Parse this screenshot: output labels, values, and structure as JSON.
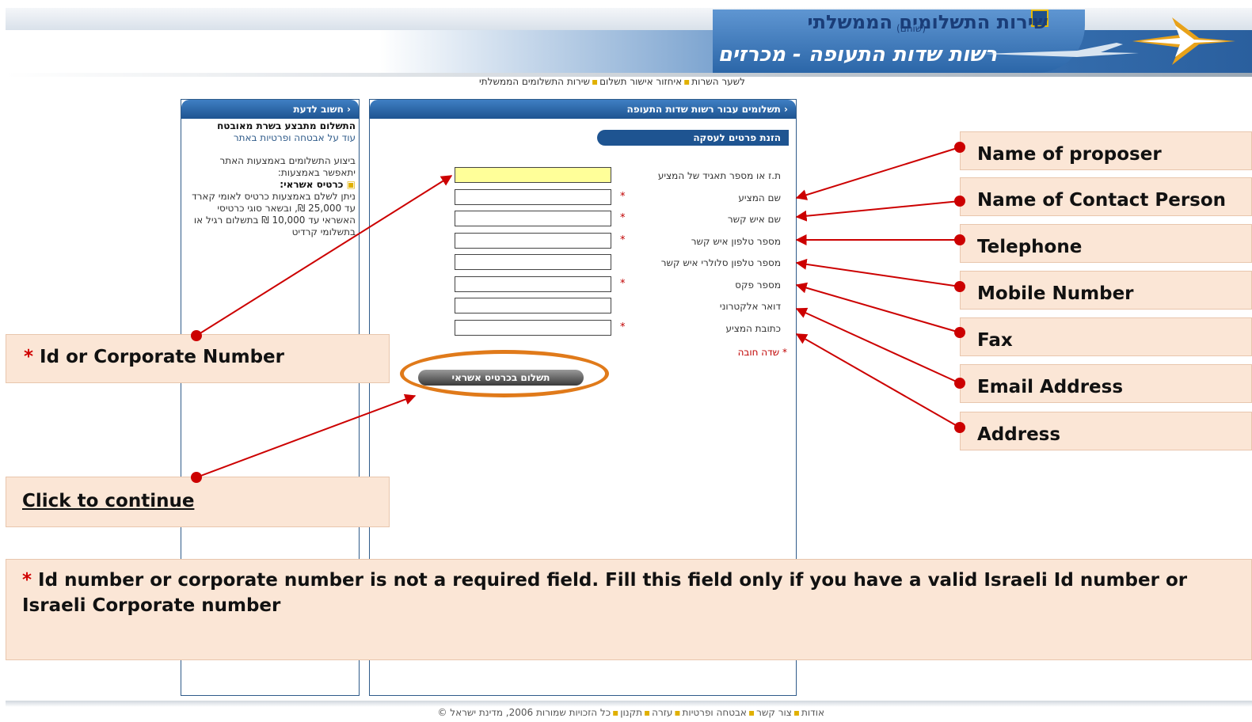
{
  "header": {
    "service_title": "שירות התשלומים הממשלתי",
    "service_subtitle": "(שוהם)",
    "airports_title": "רשות שדות התעופה - מכרזים",
    "emblem_icon": "menorah-emblem-icon",
    "logo_icon": "airports-authority-logo-icon",
    "plane_icon": "airplane-icon"
  },
  "top_nav": {
    "items": [
      "לשער השרות",
      "איחזור אישור תשלום",
      "שירות התשלומים הממשלתי"
    ]
  },
  "side_panel": {
    "title": "חשוב לדעת",
    "secure_heading": "התשלום מתבצע בשרת מאובטח",
    "security_link": "עוד על אבטחה ופרטיות באתר",
    "methods_intro": "ביצוע התשלומים באמצעות האתר יתאפשר באמצעות:",
    "credit_heading": "כרטיס אשראי:",
    "credit_text": "ניתן לשלם באמצעות כרטיס לאומי קארד עד 25,000 ₪, ובשאר סוגי כרטיסי האשראי עד 10,000 ₪ בתשלום רגיל או בתשלומי קרדיט"
  },
  "main_panel": {
    "title": "תשלומים עבור רשות שדות התעופה",
    "section_title": "הזנת פרטים לעסקה",
    "fields": [
      {
        "label": "ת.ז או מספר תאגיד של המציע",
        "value": "",
        "required": ""
      },
      {
        "label": "שם המציע",
        "value": "",
        "required": "*"
      },
      {
        "label": "שם איש קשר",
        "value": "",
        "required": "*"
      },
      {
        "label": "מספר טלפון איש קשר",
        "value": "",
        "required": "*"
      },
      {
        "label": "מספר טלפון סלולרי איש קשר",
        "value": "",
        "required": ""
      },
      {
        "label": "מספר פקס",
        "value": "",
        "required": "*"
      },
      {
        "label": "דואר אלקטרוני",
        "value": "",
        "required": ""
      },
      {
        "label": "כתובת המציע",
        "value": "",
        "required": "*"
      }
    ],
    "required_note": "* שדה חובה",
    "pay_button": "תשלום בכרטיס אשראי"
  },
  "callouts": {
    "right": [
      "Name of proposer",
      "Name of Contact Person",
      "Telephone",
      "Mobile Number",
      "Fax",
      "Email Address",
      "Address"
    ],
    "id_star": "*",
    "id_label": "Id or Corporate Number",
    "continue_label": "Click to continue",
    "note_star": "*",
    "note_text": "Id number or corporate number is not a required field. Fill this field only if you have a valid Israeli Id number or Israeli Corporate number"
  },
  "footer": {
    "items": [
      "אודות",
      "צור קשר",
      "אבטחה ופרטיות",
      "עזרה",
      "תקנון"
    ],
    "copyright": "כל הזכויות שמורות 2006, מדינת ישראל ©"
  },
  "colors": {
    "brand_blue": "#1e5491",
    "callout_bg": "#fbe6d6",
    "arrow_red": "#cc0000",
    "highlight_orange": "#e07a1a",
    "id_field_bg": "#ffff99"
  }
}
